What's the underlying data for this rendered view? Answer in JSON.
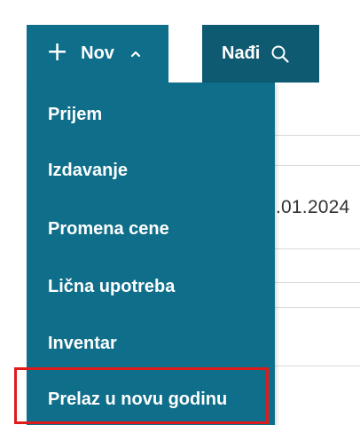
{
  "toolbar": {
    "new_label": "Nov",
    "find_label": "Nađi",
    "new_icon": "plus-icon",
    "new_caret_icon": "chevron-up-icon",
    "find_icon": "search-icon"
  },
  "menu": {
    "items": [
      {
        "label": "Prijem"
      },
      {
        "label": "Izdavanje"
      },
      {
        "label": "Promena cene"
      },
      {
        "label": "Lična upotreba"
      },
      {
        "label": "Inventar"
      },
      {
        "label": "Prelaz u novu godinu"
      }
    ]
  },
  "background": {
    "date_fragment": ".01.2024"
  },
  "colors": {
    "menu_bg": "#0f6e8a",
    "find_bg": "#0e5a70",
    "highlight": "#e01b1b"
  }
}
